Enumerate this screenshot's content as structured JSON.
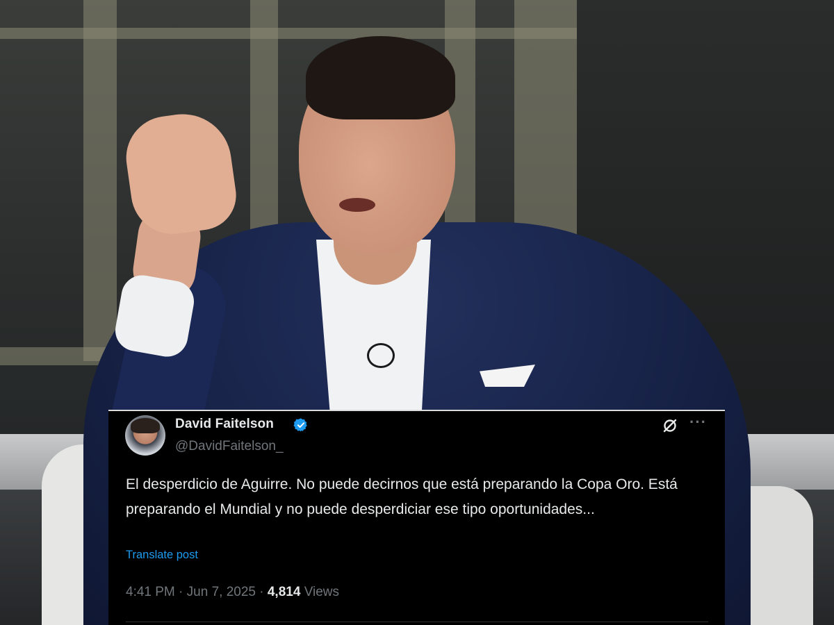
{
  "photo": {
    "subject": "man-in-navy-blazer-gesturing",
    "icons": {
      "mic": "lapel-mic-icon"
    }
  },
  "tweet": {
    "display_name": "David Faitelson",
    "handle": "@DavidFaitelson_",
    "verified_icon": "verified-badge-icon",
    "verified_color": "#1d9bf0",
    "text": "El desperdicio de Aguirre. No puede decirnos que está preparando la Copa Oro. Está preparando el Mundial y no puede desperdiciar ese tipo oportunidades...",
    "translate_label": "Translate post",
    "time": "4:41 PM",
    "separator": "·",
    "date": "Jun 7, 2025",
    "views_count": "4,814",
    "views_label": "Views",
    "more_icon": "more-options-icon",
    "more_glyph": "···",
    "grok_icon": "grok-icon",
    "background_color": "#000000",
    "text_color": "#e7e9ea",
    "muted_color": "#71767b",
    "link_color": "#1d9bf0"
  }
}
